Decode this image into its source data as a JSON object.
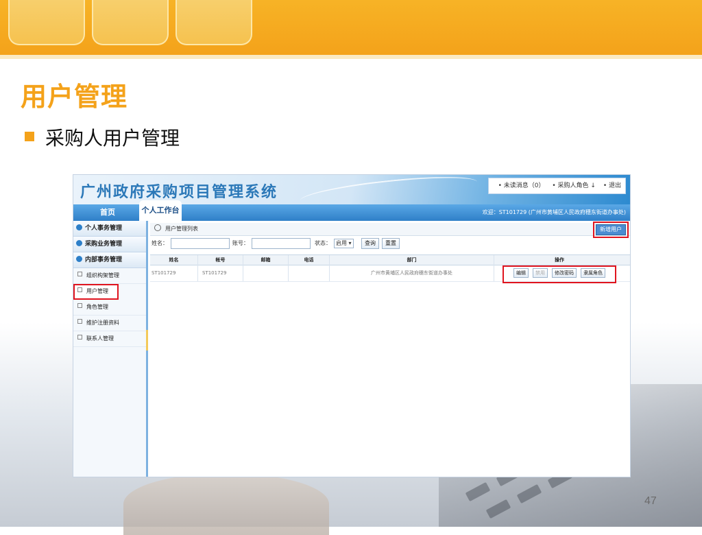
{
  "slide": {
    "title": "用户管理",
    "bullet": "采购人用户管理",
    "page_number": "47"
  },
  "app": {
    "title": "广州政府采购项目管理系统",
    "top_links": [
      "• 未读消息（0）",
      "• 采购人角色 ↓",
      "• 退出"
    ],
    "nav": {
      "home": "首页",
      "active_tab": "个人工作台",
      "welcome": "欢迎：ST101729 (广州市黄埔区人民政府穗东街道办事处)"
    },
    "sidebar": {
      "groups": [
        "个人事务管理",
        "采购业务管理",
        "内部事务管理"
      ],
      "items": [
        "组织构架管理",
        "用户管理",
        "角色管理",
        "维护注册资料",
        "联系人管理"
      ]
    },
    "main": {
      "header": "用户管理列表",
      "new_user_button": "新增用户",
      "filter": {
        "name_label": "姓名：",
        "account_label": "账号：",
        "status_label": "状态：",
        "status_value": "启用",
        "search_button": "查询",
        "reset_button": "重置"
      },
      "table": {
        "columns": [
          "姓名",
          "帐号",
          "邮箱",
          "电话",
          "部门",
          "操作"
        ],
        "rows": [
          {
            "name": "ST101729",
            "account": "ST101729",
            "email": "",
            "phone": "",
            "department": "广州市黄埔区人民政府穗东街道办事处",
            "actions": [
              "编辑",
              "禁用",
              "修改密码",
              "隶属角色"
            ]
          }
        ]
      }
    }
  },
  "colors": {
    "accent": "#f4a21a",
    "highlight": "#e0141e",
    "nav": "#2f7fc8"
  }
}
